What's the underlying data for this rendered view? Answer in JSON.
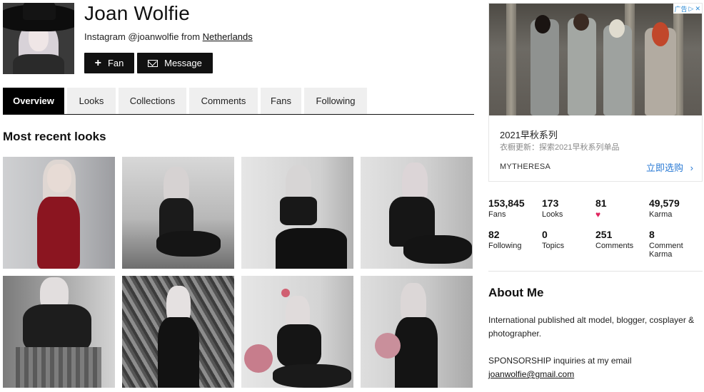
{
  "profile": {
    "name": "Joan Wolfie",
    "insta_prefix": "Instagram @joanwolfie from ",
    "country": "Netherlands",
    "fan_label": "Fan",
    "message_label": "Message"
  },
  "tabs": [
    {
      "label": "Overview",
      "active": true
    },
    {
      "label": "Looks",
      "active": false
    },
    {
      "label": "Collections",
      "active": false
    },
    {
      "label": "Comments",
      "active": false
    },
    {
      "label": "Fans",
      "active": false
    },
    {
      "label": "Following",
      "active": false
    }
  ],
  "recent_looks": {
    "title": "Most recent looks",
    "thumb_count": 8
  },
  "ad": {
    "badge": "广告",
    "title": "2021早秋系列",
    "subtitle": "衣橱更新：探索2021早秋系列单品",
    "brand": "MYTHERESA",
    "cta": "立即选购"
  },
  "stats": [
    {
      "value": "153,845",
      "label": "Fans"
    },
    {
      "value": "173",
      "label": "Looks"
    },
    {
      "value": "81",
      "label": "",
      "icon": "heart-icon"
    },
    {
      "value": "49,579",
      "label": "Karma"
    },
    {
      "value": "82",
      "label": "Following"
    },
    {
      "value": "0",
      "label": "Topics"
    },
    {
      "value": "251",
      "label": "Comments"
    },
    {
      "value": "8",
      "label": "Comment Karma"
    }
  ],
  "about": {
    "title": "About Me",
    "line1": "International published alt model, blogger, cosplayer & photographer.",
    "line2": "SPONSORSHIP inquiries at my email",
    "email": "joanwolfie@gmail.com"
  },
  "colors": {
    "accent": "#000000",
    "link": "#2a7ad4",
    "heart": "#e0245e"
  }
}
